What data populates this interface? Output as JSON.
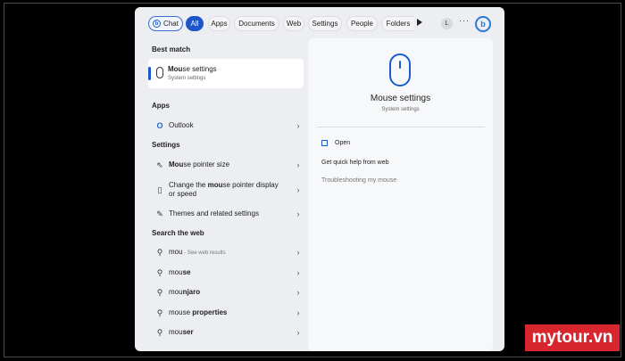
{
  "filters": {
    "chat": "Chat",
    "all": "All",
    "apps": "Apps",
    "documents": "Documents",
    "web": "Web",
    "settings": "Settings",
    "people": "People",
    "folders": "Folders",
    "avatar_letter": "L",
    "more": "···"
  },
  "left": {
    "best_match_heading": "Best match",
    "best_match": {
      "title": "Mouse settings",
      "title_bold_part": "Mou",
      "title_rest": "se settings",
      "subtitle": "System settings"
    },
    "apps_heading": "Apps",
    "apps": [
      {
        "label": "Outlook",
        "icon": "outlook-icon"
      }
    ],
    "settings_heading": "Settings",
    "settings": [
      {
        "bold": "Mou",
        "rest": "se pointer size",
        "icon": "pointer-icon"
      },
      {
        "pre": "Change the ",
        "bold": "mou",
        "rest": "se pointer display",
        "line2": "or speed",
        "icon": "mouse-icon"
      },
      {
        "label": "Themes and related settings",
        "icon": "brush-icon"
      }
    ],
    "web_heading": "Search the web",
    "web": [
      {
        "query": "mou",
        "suffix": " - See web results"
      },
      {
        "query": "mou",
        "rest": "se"
      },
      {
        "query": "mou",
        "rest": "njaro"
      },
      {
        "query": "mou",
        "rest": "se ",
        "bold_tail": "properties"
      },
      {
        "query": "mou",
        "rest": "ser"
      }
    ]
  },
  "right": {
    "title": "Mouse settings",
    "subtitle": "System settings",
    "actions": [
      "Open",
      "Get quick help from web",
      "Troubleshooting my mouse"
    ]
  },
  "watermark": "mytour.vn",
  "colors": {
    "accent": "#1e56c8",
    "bing": "#2a78d8",
    "watermark_bg": "#d8262f"
  }
}
